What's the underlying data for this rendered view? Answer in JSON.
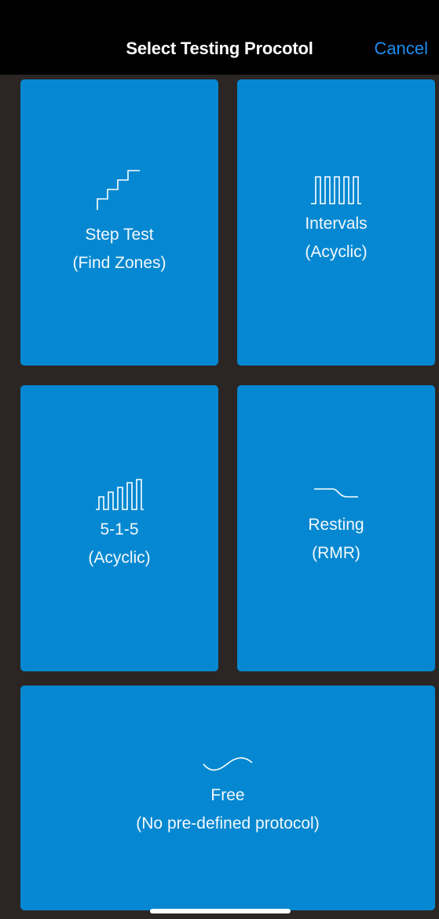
{
  "header": {
    "title": "Select Testing Procotol",
    "cancel_label": "Cancel"
  },
  "protocols": [
    {
      "icon": "stairs-icon",
      "label_line1": "Step Test",
      "label_line2": "(Find Zones)"
    },
    {
      "icon": "square-wave-icon",
      "label_line1": "Intervals",
      "label_line2": "(Acyclic)"
    },
    {
      "icon": "rising-bars-wave-icon",
      "label_line1": "5-1-5",
      "label_line2": "(Acyclic)"
    },
    {
      "icon": "declining-curve-icon",
      "label_line1": "Resting",
      "label_line2": "(RMR)"
    },
    {
      "icon": "sine-wave-icon",
      "label_line1": "Free",
      "label_line2": "(No pre-defined protocol)"
    }
  ],
  "colors": {
    "tile": "#0588d1",
    "background": "#2b2624",
    "accent": "#1e8cf0"
  }
}
